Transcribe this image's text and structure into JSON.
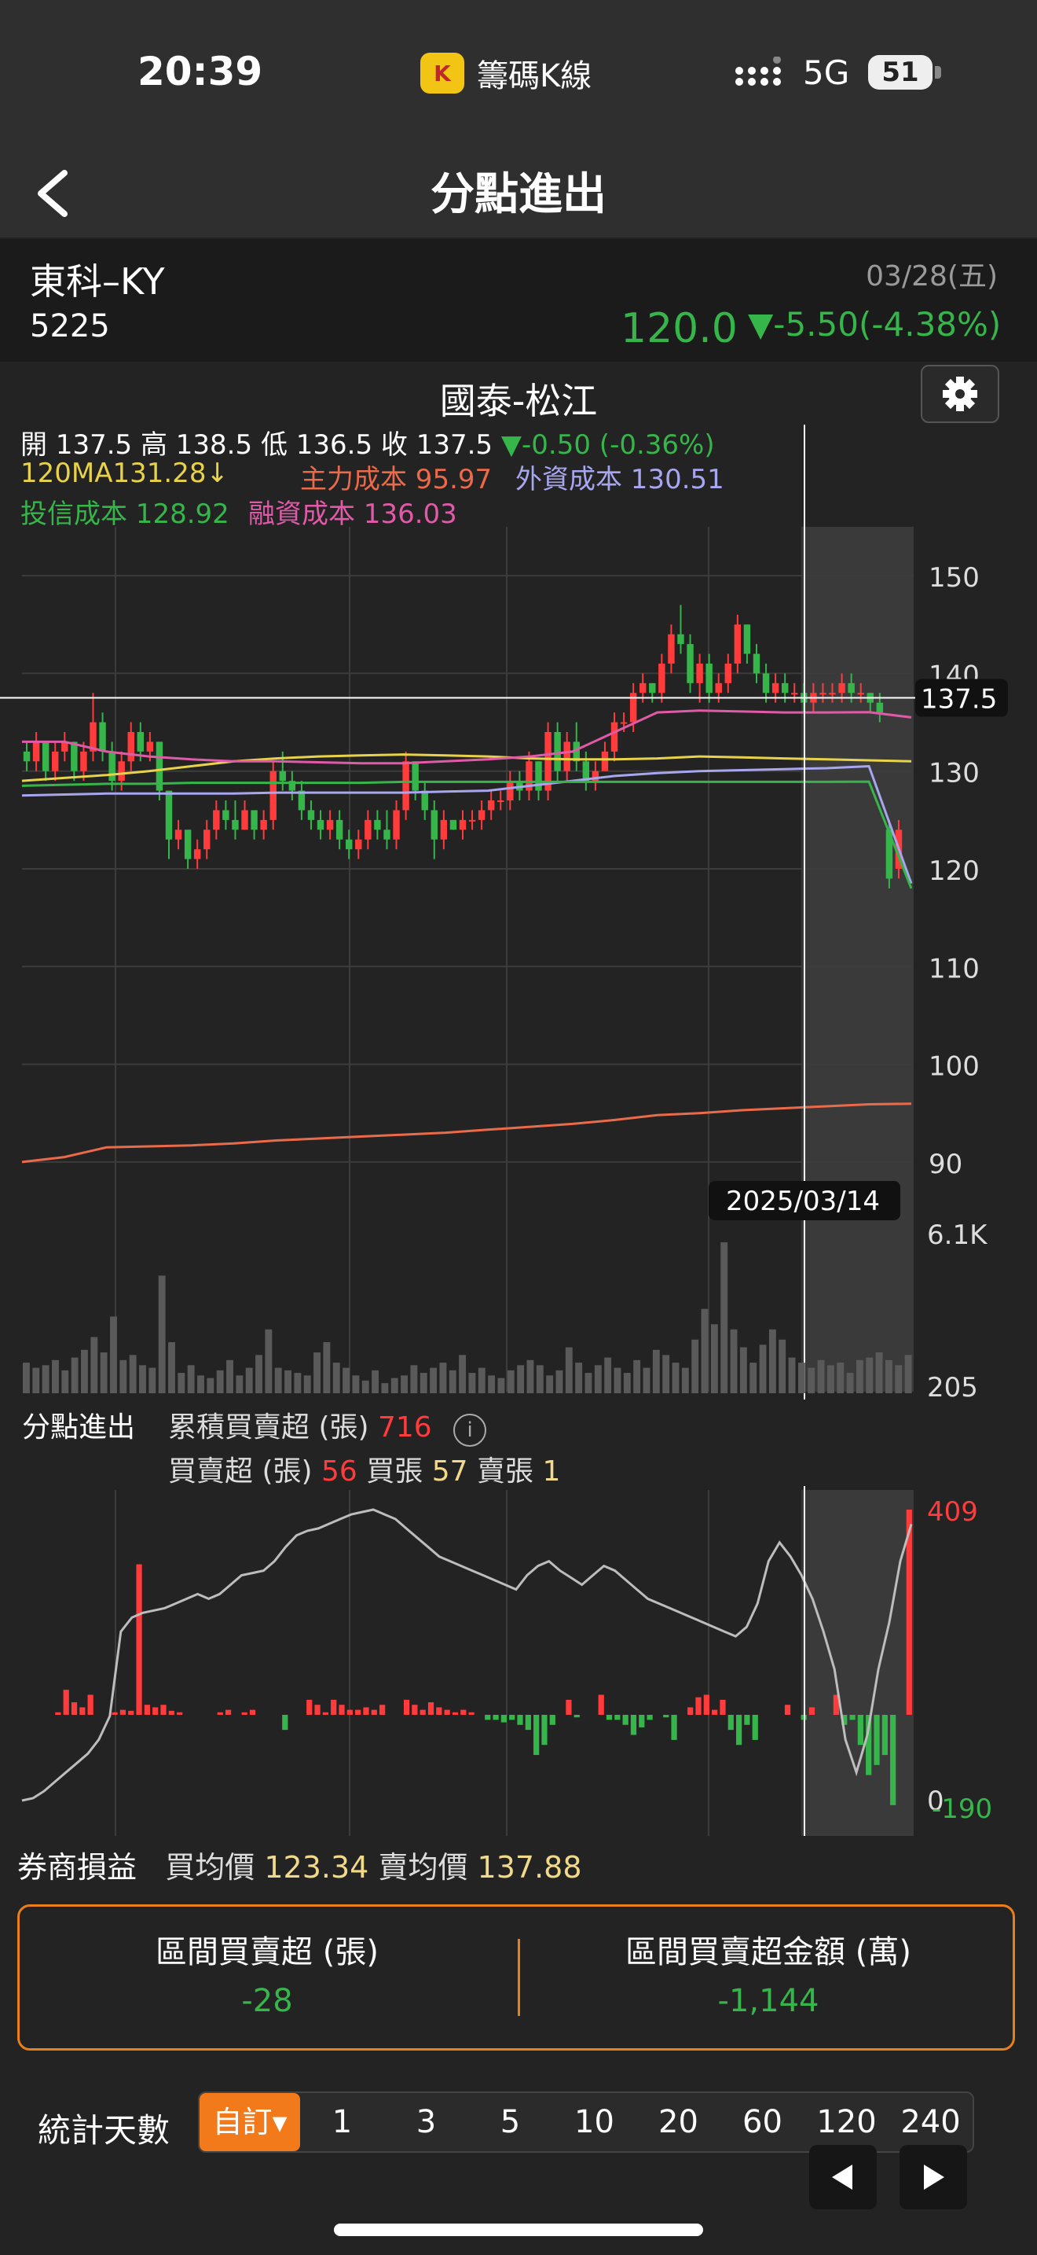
{
  "status_bar": {
    "time": "20:39",
    "app_name": "籌碼K線",
    "app_logo_text": "K",
    "network": "5G",
    "battery": "51"
  },
  "nav": {
    "title": "分點進出"
  },
  "stock": {
    "name": "東科–KY",
    "code": "5225",
    "date": "03/28(五)",
    "price": "120.0",
    "change": "▼-5.50(-4.38%)"
  },
  "broker": {
    "name": "國泰-松江"
  },
  "ohlc": {
    "open_label": "開",
    "open": "137.5",
    "high_label": "高",
    "high": "138.5",
    "low_label": "低",
    "low": "136.5",
    "close_label": "收",
    "close": "137.5",
    "change": "▼-0.50 (-0.36%)"
  },
  "indicators": {
    "ma120": "120MA131.28↓",
    "main_cost": "主力成本 95.97",
    "foreign_cost": "外資成本 130.51",
    "trust_cost": "投信成本 128.92",
    "margin_cost": "融資成本 136.03"
  },
  "colors": {
    "up": "#ff3b3b",
    "down": "#35b54a",
    "ma120": "#e8d24a",
    "main": "#ea6a4a",
    "foreign": "#a9a6f0",
    "trust": "#35b54a",
    "margin": "#e05aa8",
    "accent": "#f27a1a"
  },
  "price_axis": {
    "labels": [
      "150",
      "140",
      "130",
      "120",
      "110",
      "100",
      "90"
    ],
    "cursor_price": "137.5",
    "cursor_date": "2025/03/14"
  },
  "volume_axis": {
    "max": "6.1K",
    "min": "205"
  },
  "flow": {
    "section_label": "分點進出",
    "cum_label": "累積買賣超 (張)",
    "cum_value": "716",
    "net_label": "買賣超 (張)",
    "net_value": "56",
    "buy_label": "買張",
    "buy_value": "57",
    "sell_label": "賣張",
    "sell_value": "1",
    "axis_top": "409",
    "axis_bottom": "-190",
    "axis_zero": "0"
  },
  "broker_pnl": {
    "label": "券商損益",
    "buy_avg_label": "買均價",
    "buy_avg": "123.34",
    "sell_avg_label": "賣均價",
    "sell_avg": "137.88"
  },
  "interval": {
    "net_label": "區間買賣超 (張)",
    "net_value": "-28",
    "amount_label": "區間買賣超金額 (萬)",
    "amount_value": "-1,144"
  },
  "days": {
    "label": "統計天數",
    "options": [
      "自訂▾",
      "1",
      "3",
      "5",
      "10",
      "20",
      "60",
      "120",
      "240"
    ],
    "selected_index": 0
  },
  "chart_data": [
    {
      "type": "candlestick",
      "title": "國泰-松江",
      "ylim": [
        85,
        155
      ],
      "y_ticks": [
        150,
        140,
        130,
        120,
        110,
        100,
        90
      ],
      "candles": [
        [
          132,
          133,
          130,
          131
        ],
        [
          131,
          134,
          130,
          133
        ],
        [
          133,
          133,
          129,
          130
        ],
        [
          130,
          133,
          129,
          132
        ],
        [
          132,
          134,
          131,
          133
        ],
        [
          133,
          133,
          129,
          130
        ],
        [
          130,
          133,
          129,
          132
        ],
        [
          132,
          138,
          131,
          135
        ],
        [
          135,
          136,
          131,
          132
        ],
        [
          132,
          133,
          128,
          129
        ],
        [
          129,
          132,
          128,
          131
        ],
        [
          131,
          135,
          130,
          134
        ],
        [
          134,
          135,
          131,
          132
        ],
        [
          132,
          134,
          131,
          133
        ],
        [
          133,
          133,
          127,
          128
        ],
        [
          128,
          128,
          121,
          123
        ],
        [
          123,
          125,
          122,
          124
        ],
        [
          124,
          124,
          120,
          121
        ],
        [
          121,
          123,
          120,
          122
        ],
        [
          122,
          125,
          121,
          124
        ],
        [
          124,
          127,
          123,
          126
        ],
        [
          126,
          127,
          124,
          125
        ],
        [
          125,
          127,
          123,
          124
        ],
        [
          124,
          127,
          124,
          126
        ],
        [
          126,
          126,
          123,
          124
        ],
        [
          124,
          126,
          123,
          125
        ],
        [
          125,
          131,
          124,
          130
        ],
        [
          130,
          132,
          128,
          129
        ],
        [
          129,
          130,
          127,
          128
        ],
        [
          128,
          129,
          125,
          126
        ],
        [
          126,
          127,
          124,
          125
        ],
        [
          125,
          126,
          123,
          124
        ],
        [
          124,
          126,
          123,
          125
        ],
        [
          125,
          126,
          122,
          123
        ],
        [
          123,
          124,
          121,
          122
        ],
        [
          122,
          124,
          121,
          123
        ],
        [
          123,
          126,
          122,
          125
        ],
        [
          125,
          126,
          123,
          124
        ],
        [
          124,
          126,
          122,
          123
        ],
        [
          123,
          127,
          122,
          126
        ],
        [
          126,
          132,
          125,
          131
        ],
        [
          131,
          131,
          127,
          128
        ],
        [
          128,
          129,
          125,
          126
        ],
        [
          126,
          127,
          121,
          123
        ],
        [
          123,
          126,
          122,
          125
        ],
        [
          125,
          125,
          124,
          124
        ],
        [
          124,
          126,
          123,
          125
        ],
        [
          125,
          126,
          124,
          125
        ],
        [
          125,
          127,
          124,
          126
        ],
        [
          126,
          128,
          125,
          127
        ],
        [
          127,
          128,
          126,
          127
        ],
        [
          127,
          130,
          126,
          129
        ],
        [
          129,
          130,
          127,
          128
        ],
        [
          128,
          132,
          127,
          131
        ],
        [
          131,
          131,
          127,
          128
        ],
        [
          128,
          135,
          127,
          134
        ],
        [
          134,
          135,
          129,
          130
        ],
        [
          130,
          134,
          129,
          133
        ],
        [
          133,
          135,
          130,
          131
        ],
        [
          131,
          132,
          128,
          129
        ],
        [
          129,
          131,
          128,
          130
        ],
        [
          130,
          133,
          130,
          132
        ],
        [
          132,
          136,
          131,
          135
        ],
        [
          135,
          136,
          134,
          135
        ],
        [
          135,
          139,
          134,
          138
        ],
        [
          138,
          140,
          137,
          139
        ],
        [
          139,
          139,
          137,
          138
        ],
        [
          138,
          142,
          137,
          141
        ],
        [
          141,
          145,
          140,
          144
        ],
        [
          144,
          147,
          142,
          143
        ],
        [
          143,
          144,
          138,
          139
        ],
        [
          139,
          142,
          137,
          141
        ],
        [
          141,
          142,
          137,
          138
        ],
        [
          138,
          140,
          137,
          139
        ],
        [
          139,
          142,
          138,
          141
        ],
        [
          141,
          146,
          140,
          145
        ],
        [
          145,
          145,
          141,
          142
        ],
        [
          142,
          143,
          139,
          140
        ],
        [
          140,
          141,
          137,
          138
        ],
        [
          138,
          140,
          137,
          139
        ],
        [
          139,
          140,
          137,
          138
        ],
        [
          138,
          139,
          137,
          138
        ],
        [
          138,
          139,
          136,
          137
        ],
        [
          137,
          139,
          136,
          138
        ],
        [
          138,
          139,
          137,
          138
        ],
        [
          138,
          139,
          137,
          138
        ],
        [
          138,
          140,
          137,
          139
        ],
        [
          139,
          140,
          137,
          138
        ],
        [
          138,
          139,
          137,
          138
        ],
        [
          138,
          138,
          136,
          137
        ],
        [
          137,
          138,
          135,
          136
        ],
        [
          124,
          125,
          118,
          119
        ],
        [
          120,
          125,
          119,
          124
        ]
      ],
      "series": [
        {
          "name": "120MA",
          "values": [
            129,
            129.3,
            129.6,
            130,
            130.5,
            131,
            131.3,
            131.5,
            131.6,
            131.7,
            131.6,
            131.5,
            131.3,
            131.2,
            131.2,
            131.3,
            131.5,
            131.4,
            131.3,
            131.2,
            131.1,
            131.0
          ]
        },
        {
          "name": "主力成本",
          "values": [
            90.0,
            90.5,
            91.5,
            91.6,
            91.7,
            91.9,
            92.2,
            92.4,
            92.6,
            92.8,
            93.0,
            93.3,
            93.6,
            93.9,
            94.3,
            94.8,
            95.0,
            95.3,
            95.5,
            95.7,
            95.9,
            95.97
          ]
        },
        {
          "name": "外資成本",
          "values": [
            127.5,
            127.6,
            127.7,
            127.7,
            127.7,
            127.7,
            127.8,
            127.8,
            127.8,
            127.8,
            127.9,
            128.0,
            128.5,
            129.0,
            129.5,
            129.8,
            130.0,
            130.1,
            130.2,
            130.3,
            130.5,
            118.5
          ]
        },
        {
          "name": "投信成本",
          "values": [
            128.5,
            128.6,
            128.7,
            128.7,
            128.8,
            128.8,
            128.8,
            128.8,
            128.8,
            128.9,
            128.9,
            128.9,
            128.9,
            128.9,
            128.9,
            128.9,
            128.9,
            128.9,
            128.9,
            128.9,
            128.92,
            118.0
          ]
        },
        {
          "name": "融資成本",
          "values": [
            133.0,
            133.0,
            132.0,
            131.5,
            131.2,
            131.0,
            131.0,
            130.9,
            130.8,
            130.8,
            131.0,
            131.2,
            131.5,
            132.0,
            134.0,
            136.0,
            136.2,
            136.1,
            136.0,
            136.0,
            136.03,
            135.5
          ]
        }
      ]
    },
    {
      "type": "bar",
      "title": "",
      "ylim": [
        205,
        6100
      ],
      "values": [
        1400,
        1200,
        1300,
        1500,
        1100,
        1600,
        1900,
        2400,
        1800,
        3200,
        1500,
        1700,
        1300,
        1200,
        4800,
        2200,
        1000,
        1300,
        900,
        800,
        1100,
        1500,
        900,
        1200,
        1700,
        2700,
        1200,
        1100,
        1000,
        900,
        1800,
        2200,
        1400,
        1200,
        900,
        700,
        1100,
        600,
        800,
        900,
        1300,
        1000,
        1200,
        1400,
        1100,
        1700,
        1000,
        1200,
        900,
        800,
        1100,
        1300,
        1500,
        1300,
        900,
        1100,
        2000,
        1400,
        1000,
        1300,
        1600,
        1200,
        1000,
        1500,
        1200,
        1900,
        1700,
        1400,
        1200,
        2300,
        3500,
        2900,
        6100,
        2700,
        2000,
        1400,
        2100,
        2700,
        2300,
        1600,
        1400,
        1200,
        1500,
        1300,
        1400,
        1000,
        1500,
        1600,
        1800,
        1500,
        1300,
        1700
      ]
    },
    {
      "type": "bar",
      "title": "",
      "ylim": [
        -190,
        409
      ],
      "values": [
        0,
        0,
        0,
        0,
        5,
        50,
        25,
        15,
        40,
        0,
        0,
        5,
        10,
        8,
        300,
        20,
        15,
        20,
        8,
        5,
        0,
        0,
        0,
        0,
        5,
        10,
        0,
        5,
        10,
        0,
        0,
        0,
        -30,
        0,
        0,
        30,
        20,
        5,
        30,
        20,
        10,
        10,
        15,
        10,
        20,
        0,
        0,
        30,
        20,
        10,
        25,
        15,
        10,
        5,
        10,
        5,
        0,
        -10,
        -10,
        -15,
        -10,
        -20,
        -30,
        -80,
        -60,
        -20,
        0,
        30,
        -5,
        0,
        0,
        40,
        -10,
        -10,
        -20,
        -40,
        -25,
        -10,
        0,
        -5,
        -50,
        0,
        15,
        35,
        40,
        10,
        30,
        -30,
        -60,
        -20,
        -50,
        0,
        0,
        0,
        20,
        0,
        -10,
        15,
        0,
        0,
        40,
        -20,
        -10,
        -60,
        -120,
        -100,
        -80,
        -180,
        0,
        409
      ],
      "series": [
        {
          "name": "累積買賣超",
          "values": [
            -180,
            -175,
            -160,
            -140,
            -120,
            -100,
            -80,
            -50,
            0,
            180,
            210,
            220,
            225,
            230,
            240,
            250,
            260,
            250,
            260,
            280,
            300,
            305,
            310,
            330,
            360,
            385,
            395,
            400,
            410,
            420,
            430,
            435,
            440,
            430,
            420,
            400,
            380,
            360,
            340,
            330,
            320,
            310,
            300,
            290,
            280,
            270,
            300,
            320,
            330,
            310,
            295,
            280,
            300,
            320,
            310,
            290,
            270,
            250,
            240,
            230,
            220,
            210,
            200,
            190,
            180,
            170,
            190,
            240,
            330,
            370,
            340,
            300,
            250,
            180,
            100,
            -50,
            -120,
            -40,
            100,
            200,
            330,
            409
          ]
        }
      ]
    }
  ]
}
